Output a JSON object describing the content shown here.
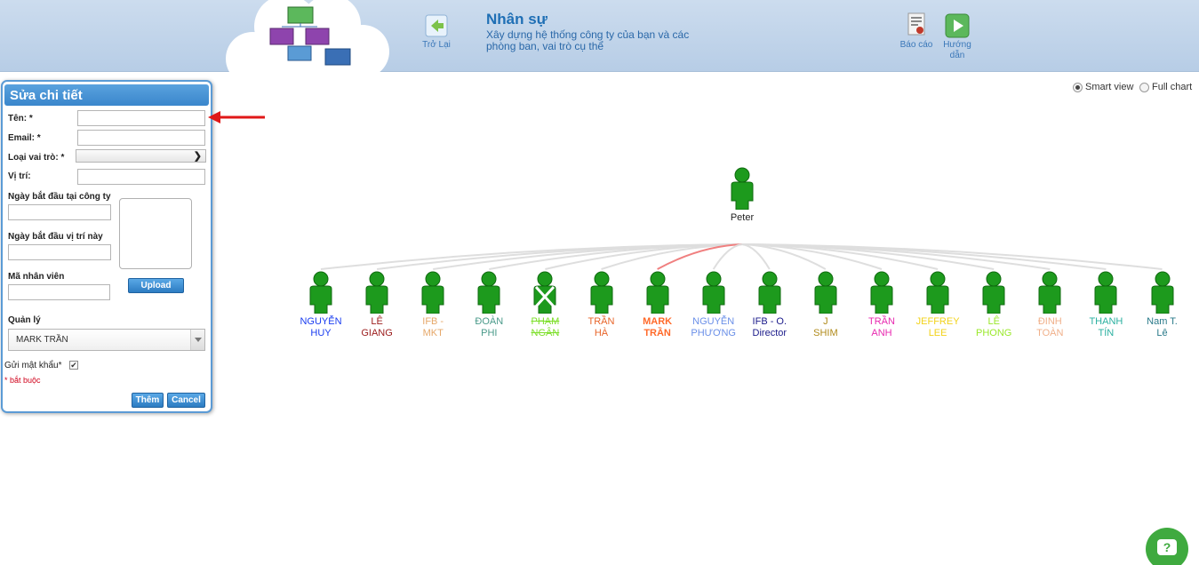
{
  "header": {
    "title": "Nhân sự",
    "description": "Xây dựng hệ thống công ty của bạn và các phòng ban, vai trò cụ thể",
    "back_label": "Trở Lại",
    "report_label": "Báo cáo",
    "guide_label": "Hướng dẫn"
  },
  "view": {
    "smart_label": "Smart view",
    "full_label": "Full chart",
    "selected": "smart"
  },
  "form": {
    "title": "Sửa chi tiết",
    "name_label": "Tên: *",
    "email_label": "Email: *",
    "role_type_label": "Loại vai trò: *",
    "position_label": "Vị trí:",
    "start_company_label": "Ngày bắt đầu tại công ty",
    "start_position_label": "Ngày bắt đầu vị trí này",
    "employee_id_label": "Mã nhân viên",
    "upload_label": "Upload",
    "manager_label": "Quản lý",
    "manager_value": "MARK TRẦN",
    "send_password_label": "Gửi mật khẩu*",
    "send_password_checked": true,
    "required_note": "* bắt buộc",
    "add_label": "Thêm",
    "cancel_label": "Cancel"
  },
  "org": {
    "root": {
      "line1": "Peter"
    },
    "children": [
      {
        "line1": "NGUYỄN",
        "line2": "HUY",
        "color": "#1a3df0",
        "crossed": false
      },
      {
        "line1": "LÊ",
        "line2": "GIANG",
        "color": "#9b1c1c",
        "crossed": false
      },
      {
        "line1": "IFB -",
        "line2": "MKT",
        "color": "#e6a86a",
        "crossed": false
      },
      {
        "line1": "ĐOÀN",
        "line2": "PHI",
        "color": "#4a9a8a",
        "crossed": false
      },
      {
        "line1": "PHẠM",
        "line2": "NGÂN",
        "color": "#7ddf2a",
        "crossed": true
      },
      {
        "line1": "TRẦN",
        "line2": "HÀ",
        "color": "#e8652a",
        "crossed": false
      },
      {
        "line1": "MARK",
        "line2": "TRẦN",
        "color": "#ff6a2a",
        "crossed": false,
        "bold": true
      },
      {
        "line1": "NGUYỄN",
        "line2": "PHƯƠNG",
        "color": "#6a8fe8",
        "crossed": false
      },
      {
        "line1": "IFB - O.",
        "line2": "Director",
        "color": "#1a1a8a",
        "crossed": false
      },
      {
        "line1": "J",
        "line2": "SHIM",
        "color": "#b08a1a",
        "crossed": false
      },
      {
        "line1": "TRẦN",
        "line2": "ANH",
        "color": "#e82ab0",
        "crossed": false
      },
      {
        "line1": "JEFFREY",
        "line2": "LEE",
        "color": "#f2d21a",
        "crossed": false
      },
      {
        "line1": "LÊ",
        "line2": "PHONG",
        "color": "#9ae82a",
        "crossed": false
      },
      {
        "line1": "ĐINH",
        "line2": "TOÀN",
        "color": "#f0b08a",
        "crossed": false
      },
      {
        "line1": "THANH",
        "line2": "TÍN",
        "color": "#2ab0a0",
        "crossed": false
      },
      {
        "line1": "Nam T.",
        "line2": "Lê",
        "color": "#2a7a8a",
        "crossed": false
      }
    ]
  }
}
